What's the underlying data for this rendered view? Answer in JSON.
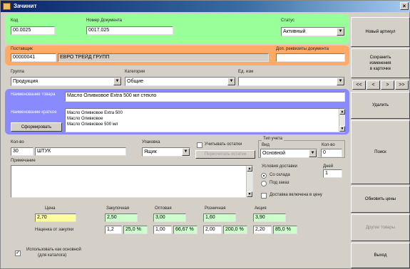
{
  "window": {
    "title": "Зачинит",
    "close": "×"
  },
  "top": {
    "code_label": "Код",
    "code_value": "00.0025",
    "doc_label": "Номер Документа",
    "doc_value": "0017.025",
    "status_label": "Статус",
    "status_value": "Активный"
  },
  "supplier": {
    "label": "Поставщик",
    "code_value": "00000041",
    "name_value": "ЕВРО ТРЕЙД ГРУПП",
    "extra_label": "Доп. реквизиты документа",
    "extra_value": ""
  },
  "selects": {
    "group_label": "Группа",
    "group_value": "Продукция",
    "category_label": "Категория",
    "category_value": "Общие",
    "unit_label": "Ед. изм",
    "unit_value": ""
  },
  "names": {
    "full_label": "Наименование товара",
    "full_value": "Масло Оливковое Extra 500 мл стекло",
    "short_label": "Наименование краткое",
    "short_value": "Масло Оливковое Extra 500\nМасло Оливковое\nМасло Оливковое 500 мл",
    "gen_button": "Сформировать"
  },
  "details": {
    "qty_label": "Кол-во",
    "qty_value": "30",
    "unit2_value": "ШТУК",
    "pack_label": "Упаковка",
    "pack_value": "Ящик",
    "chk_label": "Учитывать остатки",
    "calc_button": "Пересчитать остатки",
    "group_label": "Тип учета",
    "type_label": "Вид",
    "type_value": "Основной",
    "num_label": "Кол-во",
    "num_value": "0",
    "note_label": "Примечание",
    "note_value": ""
  },
  "delivery": {
    "header": "Условия доставки",
    "days_label": "Дней",
    "days_value": "1",
    "opt1": "Со склада",
    "opt2": "Под заказ",
    "chk_label": "Доставка включена в цену"
  },
  "prices": {
    "p1_label": "Цена",
    "p1_value": "2,70",
    "p2_label": "Закупочная",
    "p2_value": "2,50",
    "p3_label": "Оптовая",
    "p3_value": "3,00",
    "p4_label": "Розничная",
    "p4_value": "1,60",
    "p5_label": "Акция",
    "p5_value": "3,90",
    "markup_label": "Наценка от закупки",
    "m2a": "1,2",
    "m2b": "25,0 %",
    "m3a": "1,00",
    "m3b": "66,67 %",
    "m4a": "2,00",
    "m4b": "200,0 %",
    "m5a": "2,20",
    "m5b": "85,0 %"
  },
  "footer": {
    "check_label": "Использовать как основной",
    "check_sub": "(для каталога)"
  },
  "sidebar": {
    "b1": "Новый артикул",
    "b2": "Сохранить\nизменения\nв карточке",
    "nav": [
      "<<",
      "<",
      ">",
      ">>"
    ],
    "b3": "Удалить",
    "b4": "Поиск",
    "b5": "Обновить цены",
    "b6": "Другие товары",
    "b7": "Выход"
  }
}
